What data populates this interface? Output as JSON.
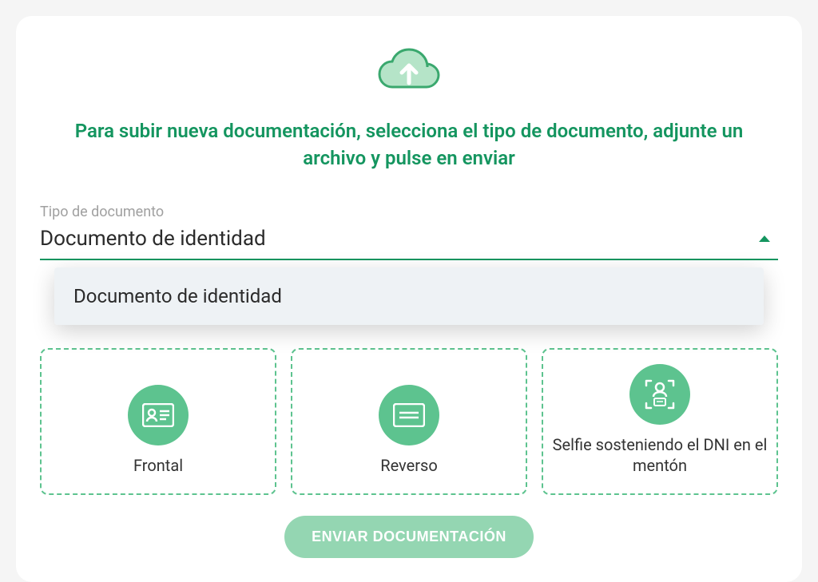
{
  "instruction": "Para subir nueva documentación, selecciona el tipo de documento, adjunte un archivo y pulse en enviar",
  "field": {
    "label": "Tipo de documento",
    "value": "Documento de identidad"
  },
  "dropdown": {
    "options": [
      {
        "label": "Documento de identidad"
      }
    ]
  },
  "slots": [
    {
      "label": "Frontal"
    },
    {
      "label": "Reverso"
    },
    {
      "label": "Selfie sosteniendo el DNI en el mentón"
    }
  ],
  "submit_label": "ENVIAR DOCUMENTACIÓN"
}
